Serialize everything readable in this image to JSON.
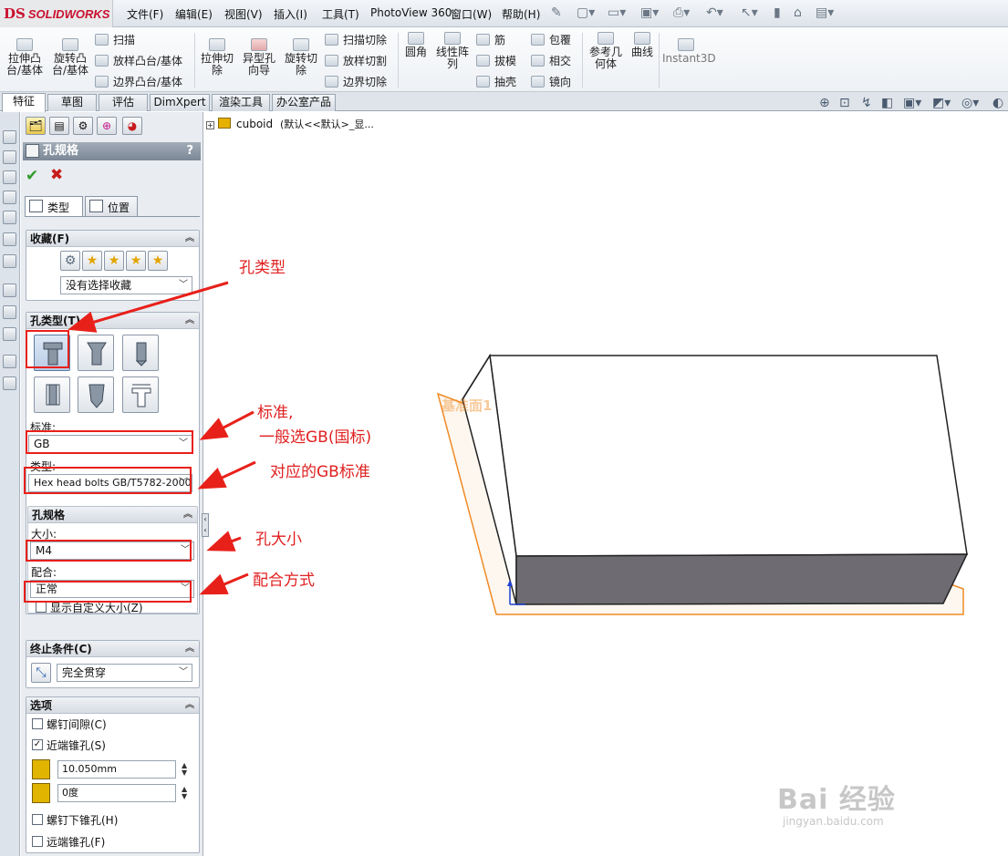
{
  "app": {
    "logo": "SOLIDWORKS",
    "logo_mark": "DS"
  },
  "menu": [
    "文件(F)",
    "编辑(E)",
    "视图(V)",
    "插入(I)",
    "工具(T)",
    "PhotoView 360",
    "窗口(W)",
    "帮助(H)"
  ],
  "ribbon": {
    "extrude_boss": "拉伸凸\n台/基体",
    "revolve_boss": "旋转凸\n台/基体",
    "sweep": "扫描",
    "loft_boss": "放样凸台/基体",
    "boundary_boss": "边界凸台/基体",
    "extrude_cut": "拉伸切\n除",
    "hole_wizard": "异型孔\n向导",
    "revolve_cut": "旋转切\n除",
    "swept_cut": "扫描切除",
    "lofted_cut": "放样切割",
    "boundary_cut": "边界切除",
    "fillet": "圆角",
    "linear_pattern": "线性阵\n列",
    "rib": "筋",
    "draft": "拔模",
    "shell": "抽壳",
    "wrap": "包覆",
    "intersect": "相交",
    "mirror": "镜向",
    "ref_geometry": "参考几\n何体",
    "curves": "曲线",
    "instant3d": "Instant3D"
  },
  "tabs": [
    "特征",
    "草图",
    "评估",
    "DimXpert",
    "渲染工具",
    "办公室产品"
  ],
  "property_manager": {
    "title": "孔规格",
    "help": "?",
    "subtabs": [
      "类型",
      "位置"
    ],
    "favorites": {
      "header": "收藏(F)",
      "select_value": "没有选择收藏"
    },
    "hole_type": {
      "header": "孔类型(T)",
      "standard_label": "标准:",
      "standard_value": "GB",
      "type_label": "类型:",
      "type_value": "Hex head bolts GB/T5782-2000"
    },
    "hole_spec": {
      "header": "孔规格",
      "size_label": "大小:",
      "size_value": "M4",
      "fit_label": "配合:",
      "fit_value": "正常",
      "custom_size": "显示自定义大小(Z)"
    },
    "end_condition": {
      "header": "终止条件(C)",
      "value": "完全贯穿"
    },
    "options": {
      "header": "选项",
      "head_clearance": "螺钉间隙(C)",
      "near_countersink": "近端锥孔(S)",
      "diameter_value": "10.050mm",
      "angle_value": "0度",
      "under_head_countersink": "螺钉下锥孔(H)",
      "far_countersink": "远端锥孔(F)"
    }
  },
  "tree": {
    "node": "cuboid",
    "suffix": "(默认<<默认>_显..."
  },
  "plane_label": "基准面1",
  "annotations": {
    "hole_type": "孔类型",
    "standard_line1": "标准,",
    "standard_line2": "一般选GB(国标)",
    "gb_standard": "对应的GB标准",
    "hole_size": "孔大小",
    "fit": "配合方式"
  },
  "watermark": {
    "brand": "Bai 经验",
    "url": "jingyan.baidu.com"
  }
}
